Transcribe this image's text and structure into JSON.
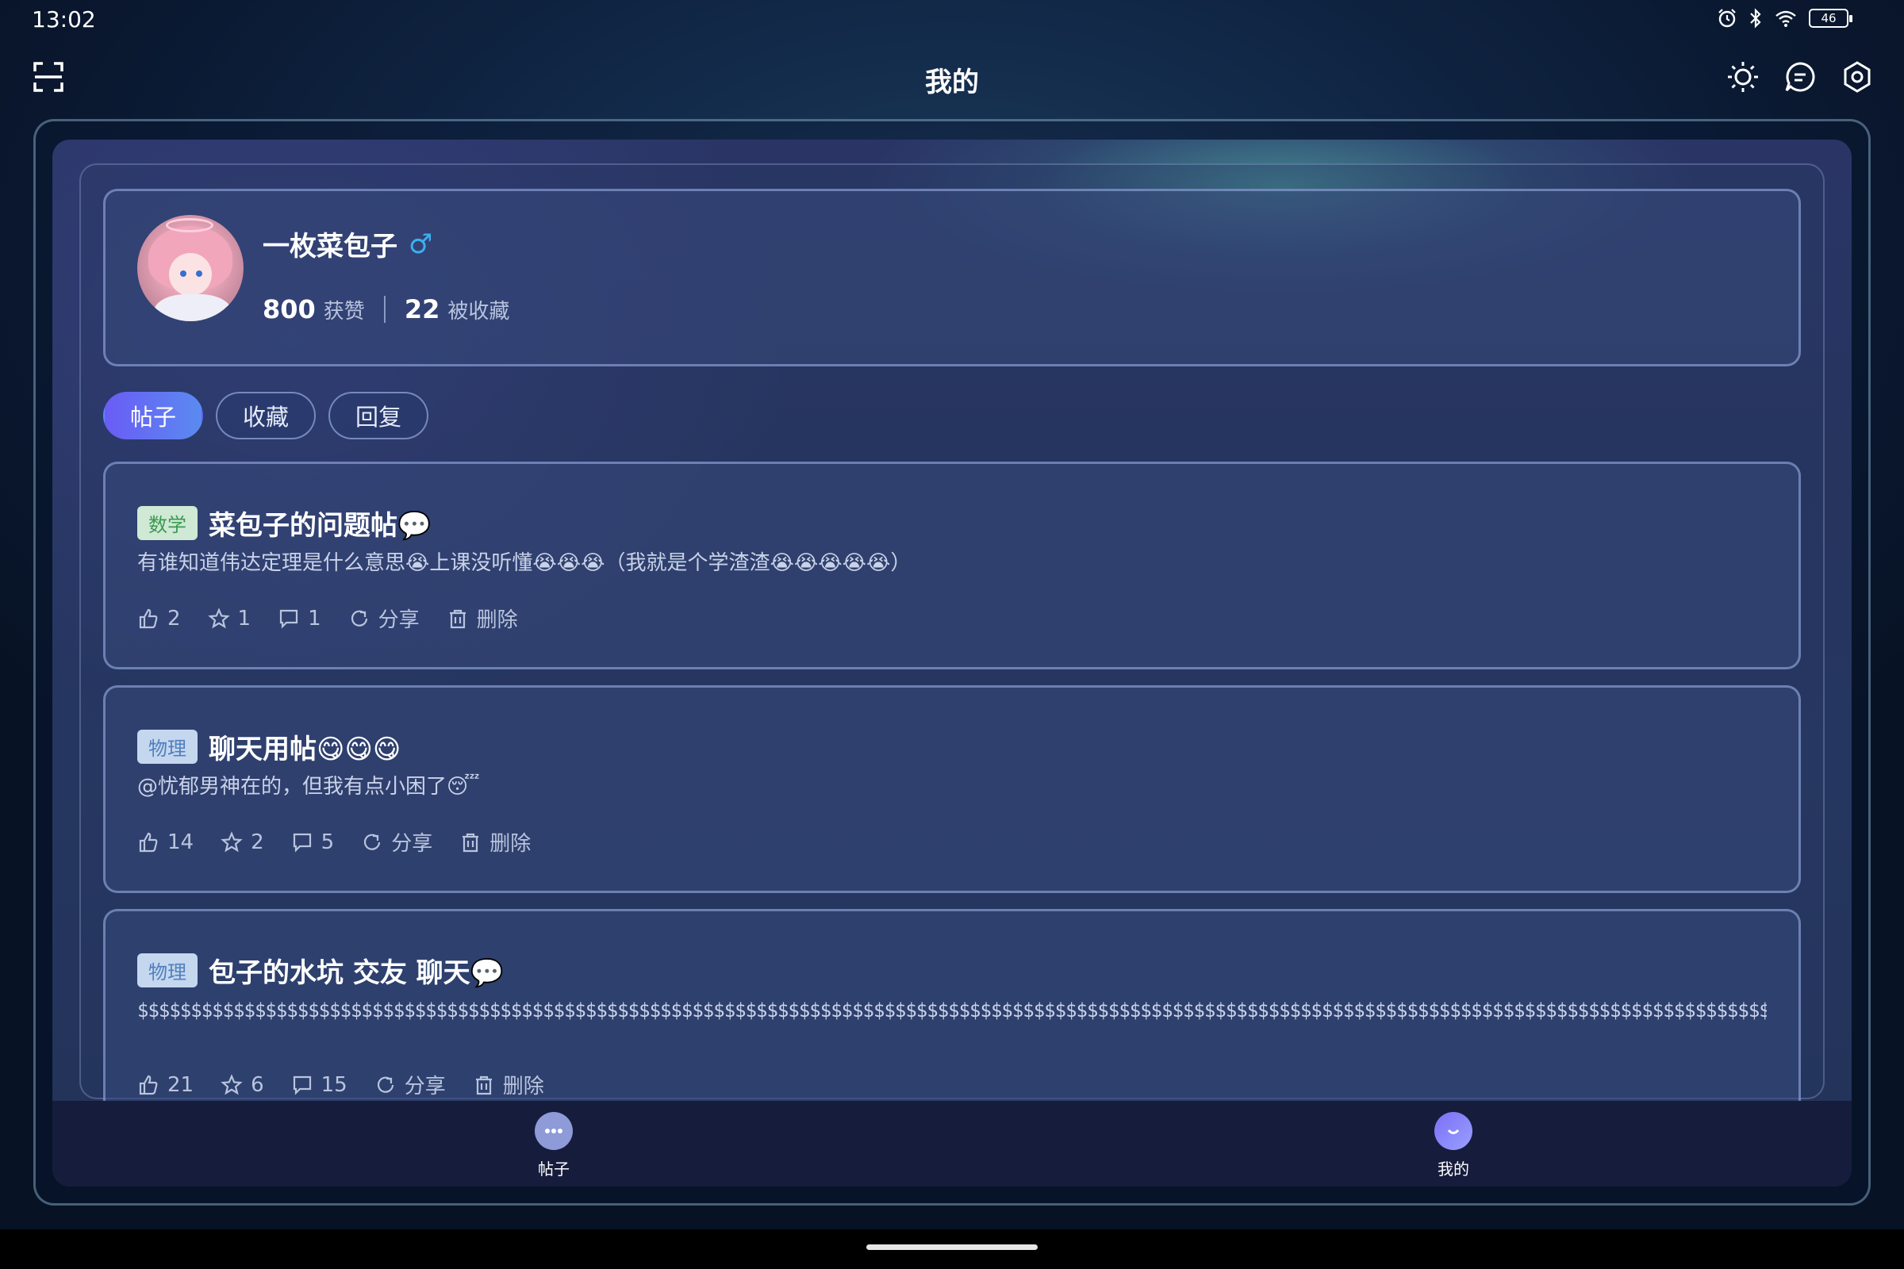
{
  "status_bar": {
    "time": "13:02",
    "battery": "46"
  },
  "header": {
    "title": "我的"
  },
  "profile": {
    "username": "一枚菜包子",
    "gender_symbol": "♂",
    "likes_count": "800",
    "likes_label": "获赞",
    "favorites_count": "22",
    "favorites_label": "被收藏"
  },
  "tabs": [
    {
      "label": "帖子",
      "active": true
    },
    {
      "label": "收藏",
      "active": false
    },
    {
      "label": "回复",
      "active": false
    }
  ],
  "posts": [
    {
      "tag": "数学",
      "title": "菜包子的问题帖💬",
      "body": "有谁知道伟达定理是什么意思😭上课没听懂😭😭😭（我就是个学渣渣😭😭😭😭😭）",
      "likes": "2",
      "favorites": "1",
      "comments": "1",
      "share_label": "分享",
      "delete_label": "删除"
    },
    {
      "tag": "物理",
      "title": "聊天用帖😋😋😋",
      "body": "@忧郁男神在的，但我有点小困了😴",
      "likes": "14",
      "favorites": "2",
      "comments": "5",
      "share_label": "分享",
      "delete_label": "删除"
    },
    {
      "tag": "物理",
      "title": "包子的水坑 交友 聊天💬",
      "body": "$$$$$$$$$$$$$$$$$$$$$$$$$$$$$$$$$$$$$$$$$$$$$$$$$$$$$$$$$$$$$$$$$$$$$$$$$$$$$$$$$$$$$$$$$$$$$$$$$$$$$$$$$$$$$$$$$$$$$$$$$$$$$$$$$$$$$$$$$$$$$$$$$$$$$$$$$$$$$$$$$$$$$$$$$$$$$$$$$$$$$$$$$$$$$$$$$$$$$$$$$$$$$$$$$$$$$$$$$$$$$$$$$$$$$$$$$$$$$$$$$$$$$$$$$$$$$$$$$$$$$$...",
      "likes": "21",
      "favorites": "6",
      "comments": "15",
      "share_label": "分享",
      "delete_label": "删除"
    }
  ],
  "bottom_nav": {
    "posts_label": "帖子",
    "mine_label": "我的"
  },
  "colors": {
    "accent": "#6a5cf5",
    "math_tag": "#3a9a52",
    "physics_tag": "#4f7fbf",
    "gender_male": "#3ab0f0"
  }
}
